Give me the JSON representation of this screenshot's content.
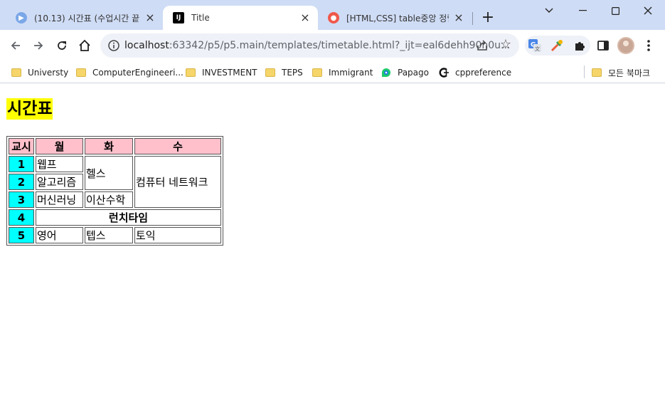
{
  "browser": {
    "tabs": [
      {
        "title": "(10.13) 시간표 (수업시간 끝",
        "active": false
      },
      {
        "title": "Title",
        "active": true
      },
      {
        "title": "[HTML,CSS] table중앙 정렬",
        "active": false
      }
    ],
    "address": {
      "host": "localhost",
      "rest": ":63342/p5/p5.main/templates/timetable.html?_ijt=eal6dehh90n0u..."
    },
    "bookmarks": [
      {
        "label": "Universty",
        "icon": "folder-icon"
      },
      {
        "label": "ComputerEngineeri...",
        "icon": "folder-icon"
      },
      {
        "label": "INVESTMENT",
        "icon": "folder-icon"
      },
      {
        "label": "TEPS",
        "icon": "folder-icon"
      },
      {
        "label": "Immigrant",
        "icon": "folder-icon"
      },
      {
        "label": "Papago",
        "icon": "papago-icon"
      },
      {
        "label": "cppreference",
        "icon": "cppreference-icon"
      },
      {
        "label": "모든 북마크",
        "icon": "folder-icon"
      }
    ]
  },
  "page": {
    "title": "시간표",
    "table": {
      "header": {
        "corner": "교시",
        "days": [
          "월",
          "화",
          "수"
        ]
      },
      "periods": [
        "1",
        "2",
        "3",
        "4",
        "5"
      ],
      "cells": {
        "p1_mon": "웹프",
        "p1_tue": "헬스",
        "p1_wed": "컴퓨터 네트워크",
        "p2_mon": "알고리즘",
        "p3_mon": "머신러닝",
        "p3_tue": "이산수학",
        "p4_lunch": "런치타임",
        "p5_mon": "영어",
        "p5_tue": "텝스",
        "p5_wed": "토익"
      }
    }
  },
  "colors": {
    "tabstrip": "#cfdcf5",
    "title_highlight": "#ffff00",
    "day_header": "#ffc0cb",
    "period_header": "#00ffff"
  }
}
